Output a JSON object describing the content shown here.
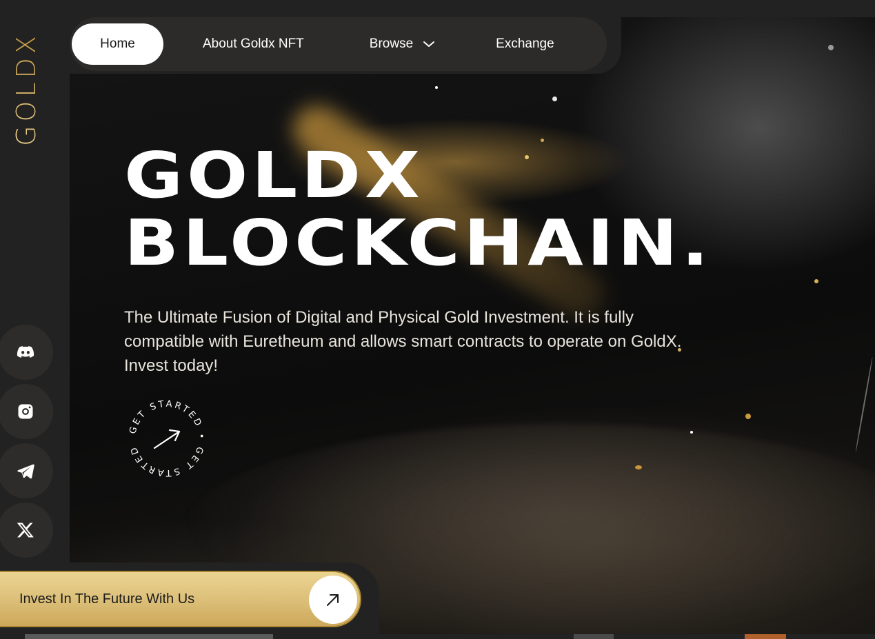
{
  "brand": {
    "logo_text": "GOLDX"
  },
  "nav": {
    "items": [
      {
        "label": "Home",
        "active": true
      },
      {
        "label": "About Goldx NFT"
      },
      {
        "label": "Browse",
        "has_dropdown": true
      },
      {
        "label": "Exchange"
      }
    ]
  },
  "hero": {
    "title_line1": "GOLDX",
    "title_line2": "BLOCKCHAIN.",
    "description": "The Ultimate Fusion of Digital and Physical Gold Investment. It is fully compatible with Euretheum and allows smart contracts to operate on GoldX. Invest today!",
    "get_started_text": "GET STARTED • GET STARTED •"
  },
  "social": [
    "discord-icon",
    "instagram-icon",
    "telegram-icon",
    "x-icon"
  ],
  "cta": {
    "label": "Invest In The Future With Us"
  },
  "colors": {
    "background": "#222222",
    "nav_bg": "#2c2b29",
    "gold_light": "#ecd491",
    "gold_dark": "#cda85a",
    "text": "#ffffff"
  }
}
